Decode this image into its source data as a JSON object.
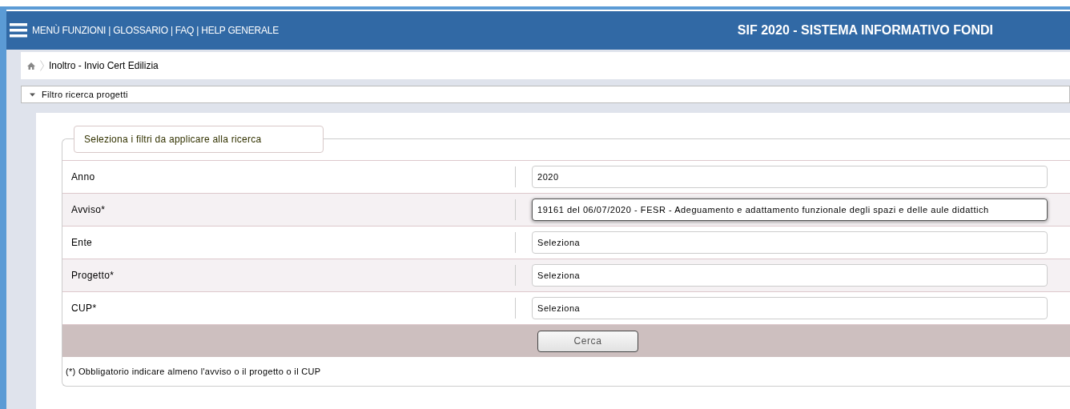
{
  "header": {
    "menu_links": "MENÙ FUNZIONI | GLOSSARIO | FAQ | HELP GENERALE",
    "title": "SIF 2020 - SISTEMA INFORMATIVO FONDI"
  },
  "breadcrumb": {
    "current": "Inoltro - Invio Cert Edilizia"
  },
  "filter_panel": {
    "title": "Filtro ricerca progetti",
    "expanded": true
  },
  "fieldset": {
    "legend": "Seleziona i filtri da applicare alla ricerca"
  },
  "filters": [
    {
      "label": "Anno",
      "value": "2020",
      "focused": false
    },
    {
      "label": "Avviso*",
      "value": "19161 del 06/07/2020 - FESR - Adeguamento e adattamento funzionale degli spazi e delle aule didattich",
      "focused": true
    },
    {
      "label": "Ente",
      "value": "Seleziona",
      "focused": false
    },
    {
      "label": "Progetto*",
      "value": "Seleziona",
      "focused": false
    },
    {
      "label": "CUP*",
      "value": "Seleziona",
      "focused": false
    }
  ],
  "search_button": "Cerca",
  "note": "(*) Obbligatorio indicare almeno l'avviso o il progetto o il CUP"
}
